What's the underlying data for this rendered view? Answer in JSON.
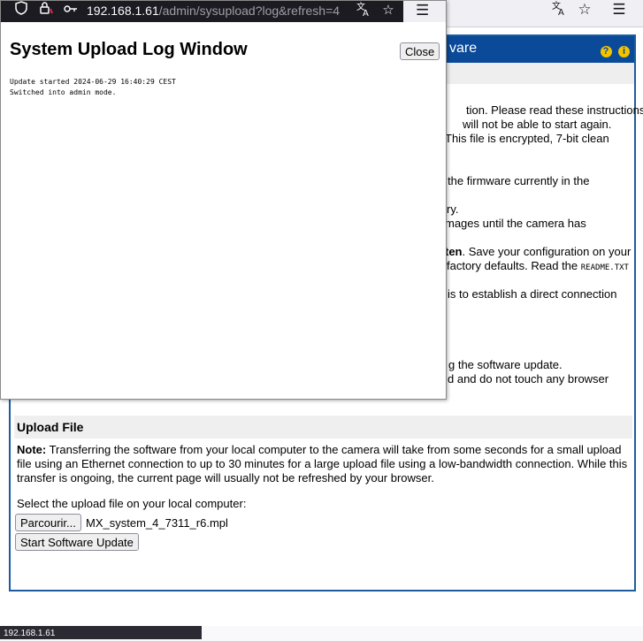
{
  "bg_browser": {
    "translate_icon": "translate-icon",
    "bookmark_icon": "star-icon",
    "menu_icon": "hamburger-menu-icon"
  },
  "bg_page": {
    "header_title_fragment": "vare",
    "help_icons": [
      "?",
      "i"
    ],
    "instructions": [
      "tion. Please read these instructions",
      "will not be able to start again.",
      "This file is encrypted, 7-bit clean",
      "ge the firmware currently in the",
      "ry.",
      "mages until the camera has",
      "ten. Save your configuration on your",
      "factory defaults. Read the ",
      "README.TXT",
      "is to establish a direct connection",
      "g the software update.",
      "d and do not touch any browser"
    ],
    "instructions_bold": "ten",
    "upload_section": {
      "heading": "Upload File",
      "note_label": "Note:",
      "note_text": " Transferring the software from your local computer to the camera will take from some seconds for a small upload file using an Ethernet connection to up to 30 minutes for a large upload file using a low-bandwidth connection. While this transfer is ongoing, the current page will usually not be refreshed by your browser.",
      "select_label": "Select the upload file on your local computer:",
      "browse_button": "Parcourir...",
      "file_name": "MX_system_4_7311_r6.mpl",
      "start_button": "Start Software Update"
    }
  },
  "status_bar": {
    "text": "192.168.1.61"
  },
  "popup": {
    "url_host": "192.168.1.61",
    "url_path": "/admin/sysupload?log&refresh=4",
    "icons": [
      "shield-icon",
      "lock-warning-icon",
      "key-icon",
      "translate-icon",
      "star-icon",
      "hamburger-menu-icon"
    ],
    "title": "System Upload Log Window",
    "close_button": "Close",
    "log_lines": [
      "Update started 2024-06-29 16:40:29 CEST",
      "Switched into admin mode."
    ]
  }
}
